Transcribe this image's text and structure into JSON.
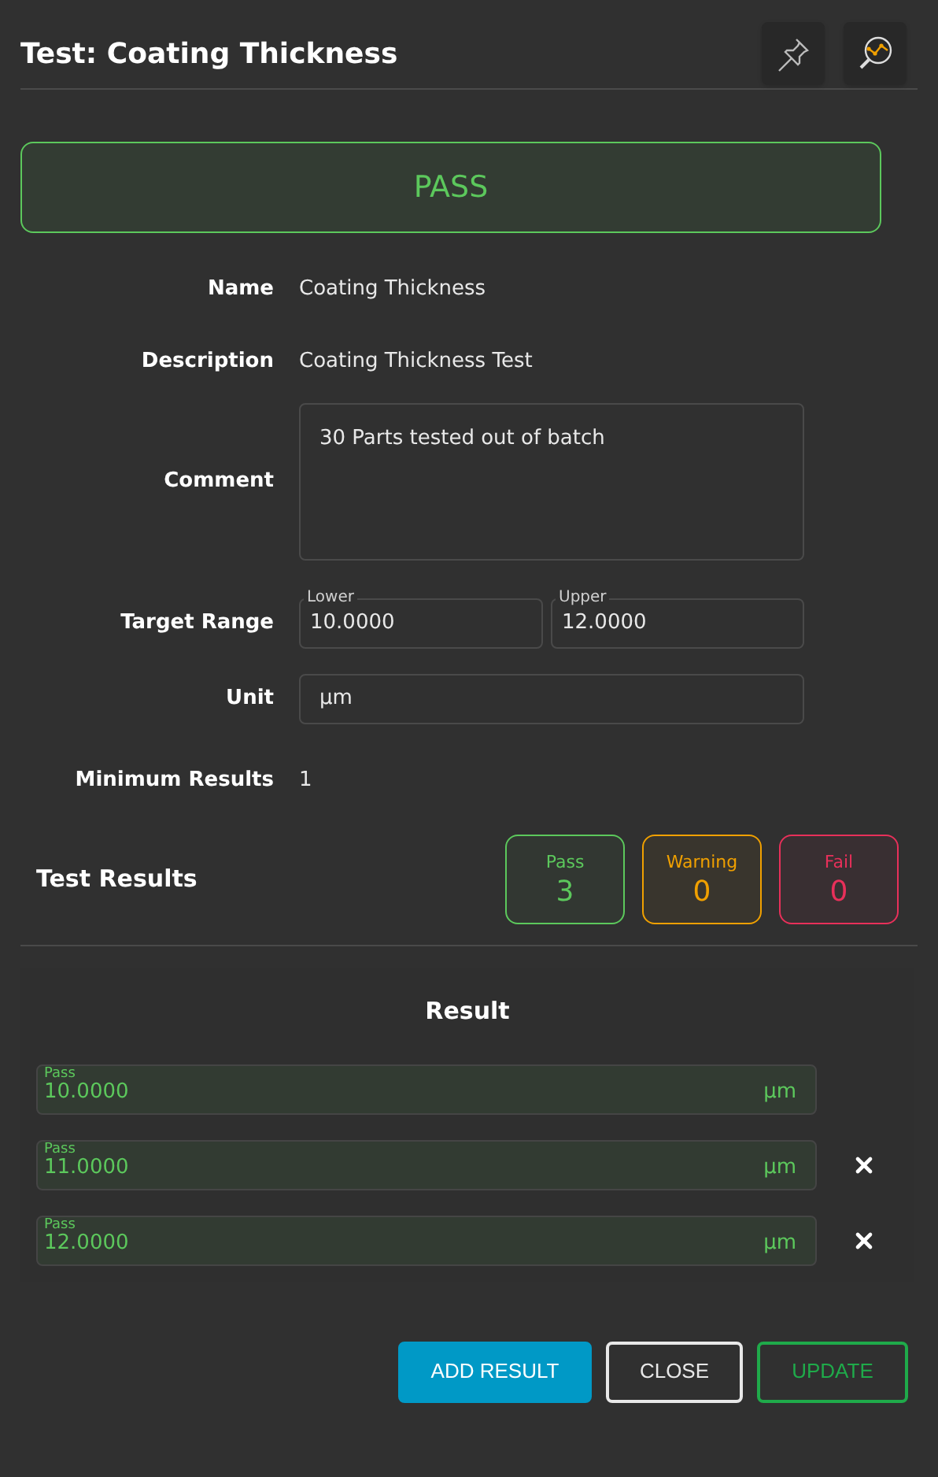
{
  "header": {
    "title": "Test: Coating Thickness"
  },
  "verdict": {
    "text": "PASS",
    "color": "#5cc85c"
  },
  "fields": [
    {
      "kind": "text",
      "label": "Name",
      "value": "Coating Thickness"
    },
    {
      "kind": "text",
      "label": "Description",
      "value": "Coating Thickness Test"
    },
    {
      "kind": "textarea",
      "label": "Comment",
      "value": "30 Parts tested out of batch"
    },
    {
      "kind": "range",
      "label": "Target Range",
      "lower_label": "Lower",
      "lower": "10.0000",
      "upper_label": "Upper",
      "upper": "12.0000"
    },
    {
      "kind": "input",
      "label": "Unit",
      "value": "µm"
    },
    {
      "kind": "text",
      "label": "Minimum Results",
      "value": "1"
    }
  ],
  "test_results": {
    "title": "Test Results",
    "counts": [
      {
        "color": "#5cc85c",
        "label": "Pass",
        "value": "3"
      },
      {
        "color": "#f0a000",
        "label": "Warning",
        "value": "0"
      },
      {
        "color": "#e8305a",
        "label": "Fail",
        "value": "0"
      }
    ]
  },
  "results": {
    "title": "Result",
    "rows": [
      {
        "color": "#5cc85c",
        "label": "Pass",
        "value": "10.0000",
        "unit": "µm",
        "removable": false
      },
      {
        "color": "#5cc85c",
        "label": "Pass",
        "value": "11.0000",
        "unit": "µm",
        "removable": true
      },
      {
        "color": "#5cc85c",
        "label": "Pass",
        "value": "12.0000",
        "unit": "µm",
        "removable": true
      }
    ]
  },
  "buttons": [
    {
      "kind": "primary",
      "label": "ADD RESULT"
    },
    {
      "kind": "outline",
      "label": "CLOSE"
    },
    {
      "kind": "success",
      "label": "UPDATE"
    }
  ]
}
